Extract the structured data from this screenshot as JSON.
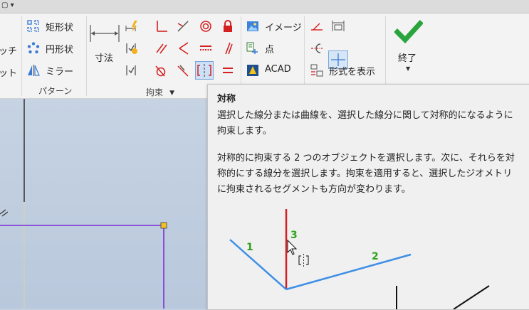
{
  "ribbon": {
    "left_cut": {
      "line1": "ッチ",
      "line2": "ット"
    },
    "pattern": {
      "rect_label": "矩形状",
      "circ_label": "円形状",
      "mirror_label": "ミラー",
      "panel_label": "パターン"
    },
    "constraint": {
      "dimension_label": "寸法",
      "panel_label": "拘束"
    },
    "insert": {
      "image_label": "イメージ",
      "point_label": "点",
      "acad_label": "ACAD"
    },
    "format": {
      "show_format_label": "形式を表示"
    },
    "finish": {
      "label": "終了"
    }
  },
  "tooltip": {
    "title": "対称",
    "desc1": "選択した線分または曲線を、選択した線分に関して対称的になるように拘束します。",
    "desc2": "対称的に拘束する 2 つのオブジェクトを選択します。次に、それらを対称的にする線分を選択します。拘束を適用すると、選択したジオメトリに拘束されるセグメントも方向が変わります。",
    "labels": [
      "1",
      "2",
      "3"
    ]
  },
  "colors": {
    "accent_check": "#2aa43c",
    "sketch_line": "#7b2fd6",
    "constraint_red": "#d42020",
    "diagram_blue": "#3d8fe6",
    "label_green": "#2fa21c"
  },
  "icons": [
    "qat-dropdown-icon",
    "rect-pattern-icon",
    "circ-pattern-icon",
    "mirror-icon",
    "dimension-icon",
    "finish-check-icon"
  ]
}
